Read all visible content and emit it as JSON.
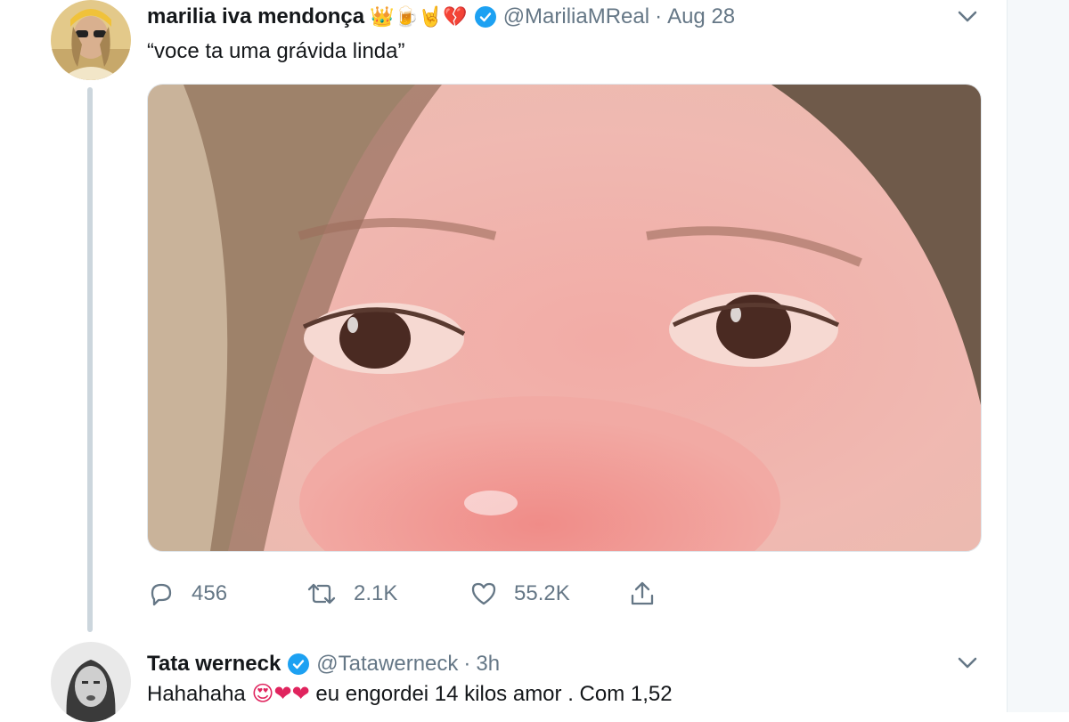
{
  "tweets": [
    {
      "display_name": "marilia iva mendonça",
      "name_emojis": "👑🍺🤘💔",
      "handle": "@MariliaMReal",
      "separator": "·",
      "time": "Aug 28",
      "text": "“voce ta uma grávida linda”",
      "media_icon": "selfie-photo-closeup-eyes",
      "actions": {
        "reply_count": "456",
        "retweet_count": "2.1K",
        "like_count": "55.2K"
      }
    },
    {
      "display_name": "Tata werneck",
      "handle": "@Tatawerneck",
      "separator": "·",
      "time": "3h",
      "text_before": "Hahahaha ",
      "text_emojis": "😍❤❤",
      "text_after": " eu engordei 14 kilos amor . Com 1,52"
    }
  ],
  "colors": {
    "verified": "#1da1f2",
    "secondary_text": "#657786",
    "thread_line": "#ccd6dd"
  }
}
